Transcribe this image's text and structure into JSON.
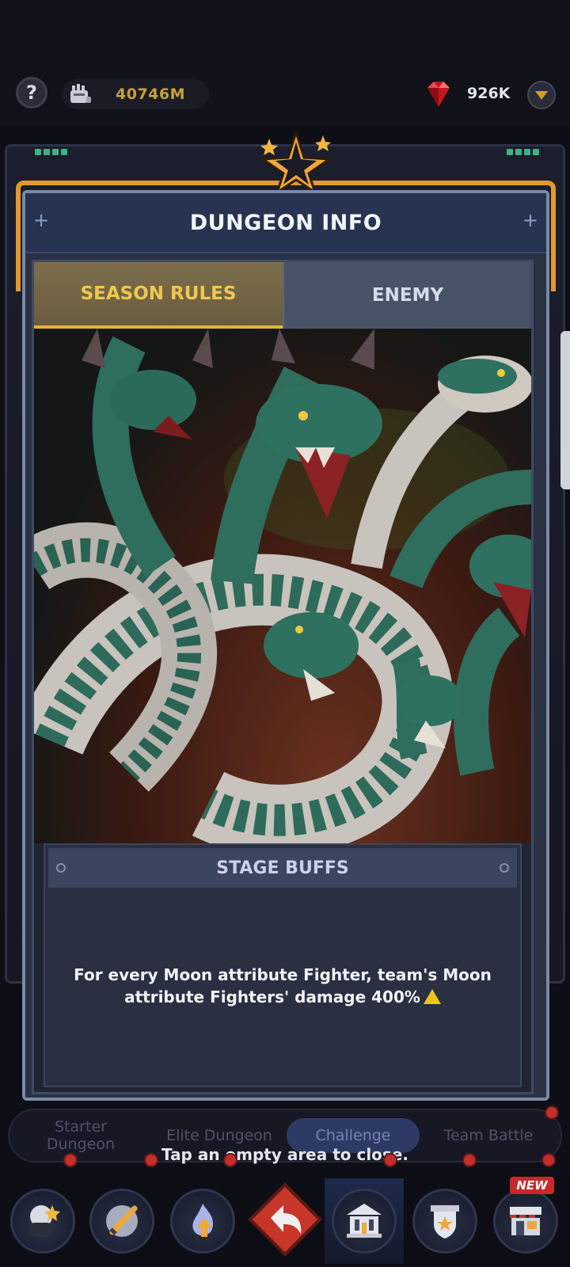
{
  "top_bar": {
    "help_label": "?",
    "power_value": "40746M",
    "gems_value": "926K"
  },
  "dialog": {
    "title": "DUNGEON INFO",
    "tabs": [
      {
        "label": "SEASON RULES",
        "active": true
      },
      {
        "label": "ENEMY",
        "active": false
      }
    ],
    "stage_buffs": {
      "title": "STAGE BUFFS",
      "text": "For every Moon attribute Fighter, team's Moon attribute Fighters' damage 400%"
    }
  },
  "dungeon_tabs": [
    {
      "label": "Starter\nDungeon"
    },
    {
      "label": "Elite Dungeon"
    },
    {
      "label": "Challenge",
      "active": true
    },
    {
      "label": "Team Battle"
    }
  ],
  "close_hint": "Tap an empty area to close.",
  "bottom_nav": {
    "new_badge": "NEW"
  },
  "colors": {
    "accent_gold": "#f0c84e",
    "frame_orange": "#e39a2d",
    "notification_red": "#c22f2c"
  }
}
